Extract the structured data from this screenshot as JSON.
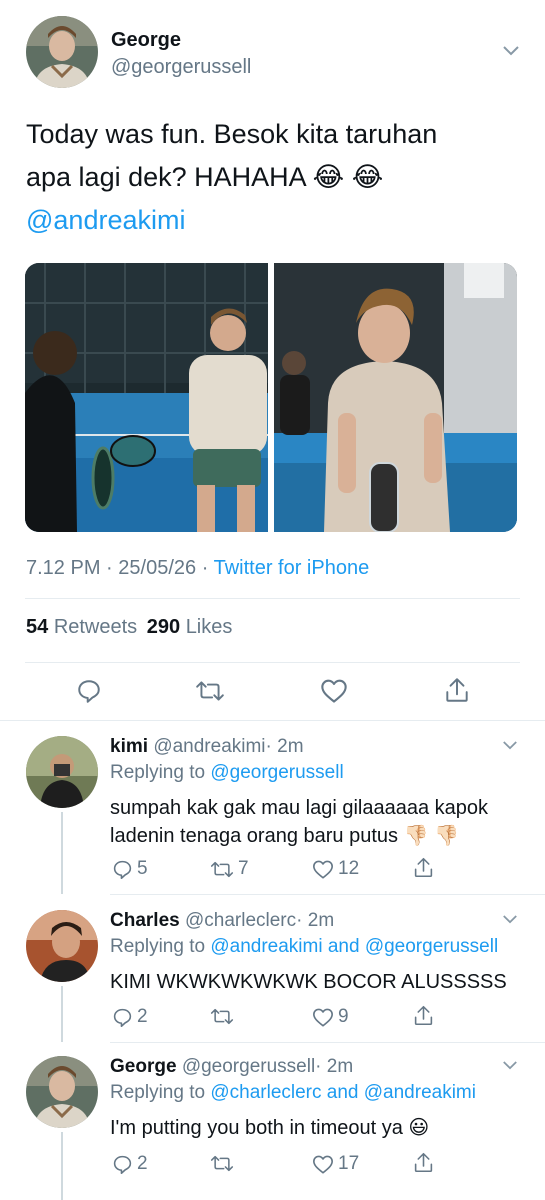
{
  "tweet": {
    "author_name": "George",
    "author_handle": "@georgerussell",
    "text_line1": "Today was fun. Besok kita taruhan",
    "text_line2": "apa lagi dek? HAHAHA 😂 😂",
    "mention": "@andreakimi",
    "time": "7.12 PM",
    "date": "25/05/26",
    "separator": "·",
    "source": "Twitter for iPhone",
    "retweets_count": "54",
    "retweets_label": "Retweets",
    "likes_count": "290",
    "likes_label": "Likes"
  },
  "actions": {
    "reply_icon": "reply-icon",
    "retweet_icon": "retweet-icon",
    "like_icon": "heart-icon",
    "share_icon": "share-icon"
  },
  "replies": [
    {
      "name": "kimi",
      "handle": "@andreakimi",
      "time": "· 2m",
      "replying_label": "Replying to",
      "replying_to": "@georgerussell",
      "text_line1": "sumpah kak gak mau lagi gilaaaaaa kapok",
      "text_line2": "ladenin tenaga orang baru putus 👎🏻 👎🏻",
      "reply_count": "5",
      "retweet_count": "7",
      "like_count": "12"
    },
    {
      "name": "Charles",
      "handle": "@charleclerc",
      "time": "· 2m",
      "replying_label": "Replying to",
      "replying_to": "@andreakimi and @georgerussell",
      "text_line1": "KIMI WKWKWKWKWK BOCOR ALUSSSSS",
      "reply_count": "2",
      "retweet_count": "",
      "like_count": "9"
    },
    {
      "name": "George",
      "handle": "@georgerussell",
      "time": "· 2m",
      "replying_label": "Replying to",
      "replying_to": "@charleclerc and @andreakimi",
      "text_line1": "I'm putting you both in timeout ya 😃",
      "reply_count": "2",
      "retweet_count": "",
      "like_count": "17"
    }
  ],
  "colors": {
    "link": "#1d9bf0",
    "secondary_text": "#657786",
    "divider": "#e6ecf0"
  }
}
